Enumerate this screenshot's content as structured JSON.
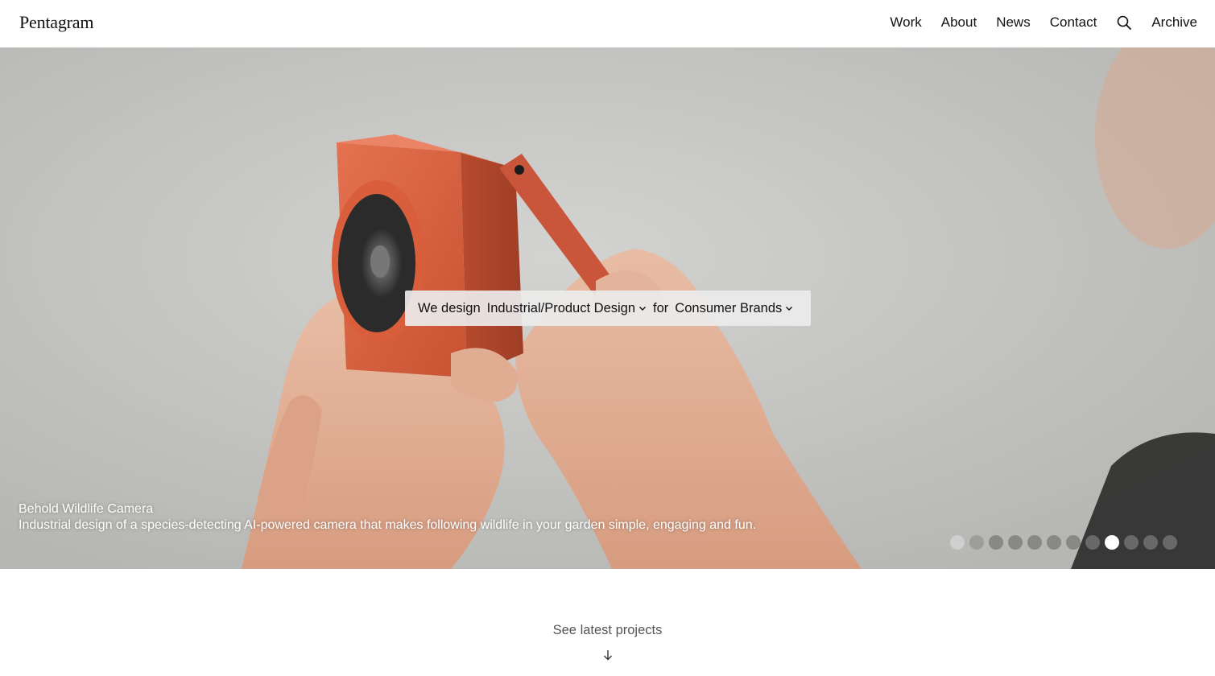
{
  "header": {
    "logo": "Pentagram",
    "nav": [
      {
        "label": "Work"
      },
      {
        "label": "About"
      },
      {
        "label": "News"
      },
      {
        "label": "Contact"
      }
    ],
    "search_icon": "search-icon",
    "archive": "Archive"
  },
  "hero": {
    "selector": {
      "prefix": "We design",
      "discipline": "Industrial/Product Design",
      "connector": "for",
      "sector": "Consumer Brands"
    },
    "caption": {
      "title": "Behold Wildlife Camera",
      "description": "Industrial design of a species-detecting AI-powered camera that makes following wildlife in your garden simple, engaging and fun."
    },
    "slides": {
      "count": 12,
      "active_index": 8
    }
  },
  "below": {
    "latest_label": "See latest projects",
    "arrow_icon": "arrow-down-icon"
  },
  "colors": {
    "camera_orange": "#d9643f",
    "lens_black": "#2a2a2a",
    "skin": "#e3b49b"
  }
}
